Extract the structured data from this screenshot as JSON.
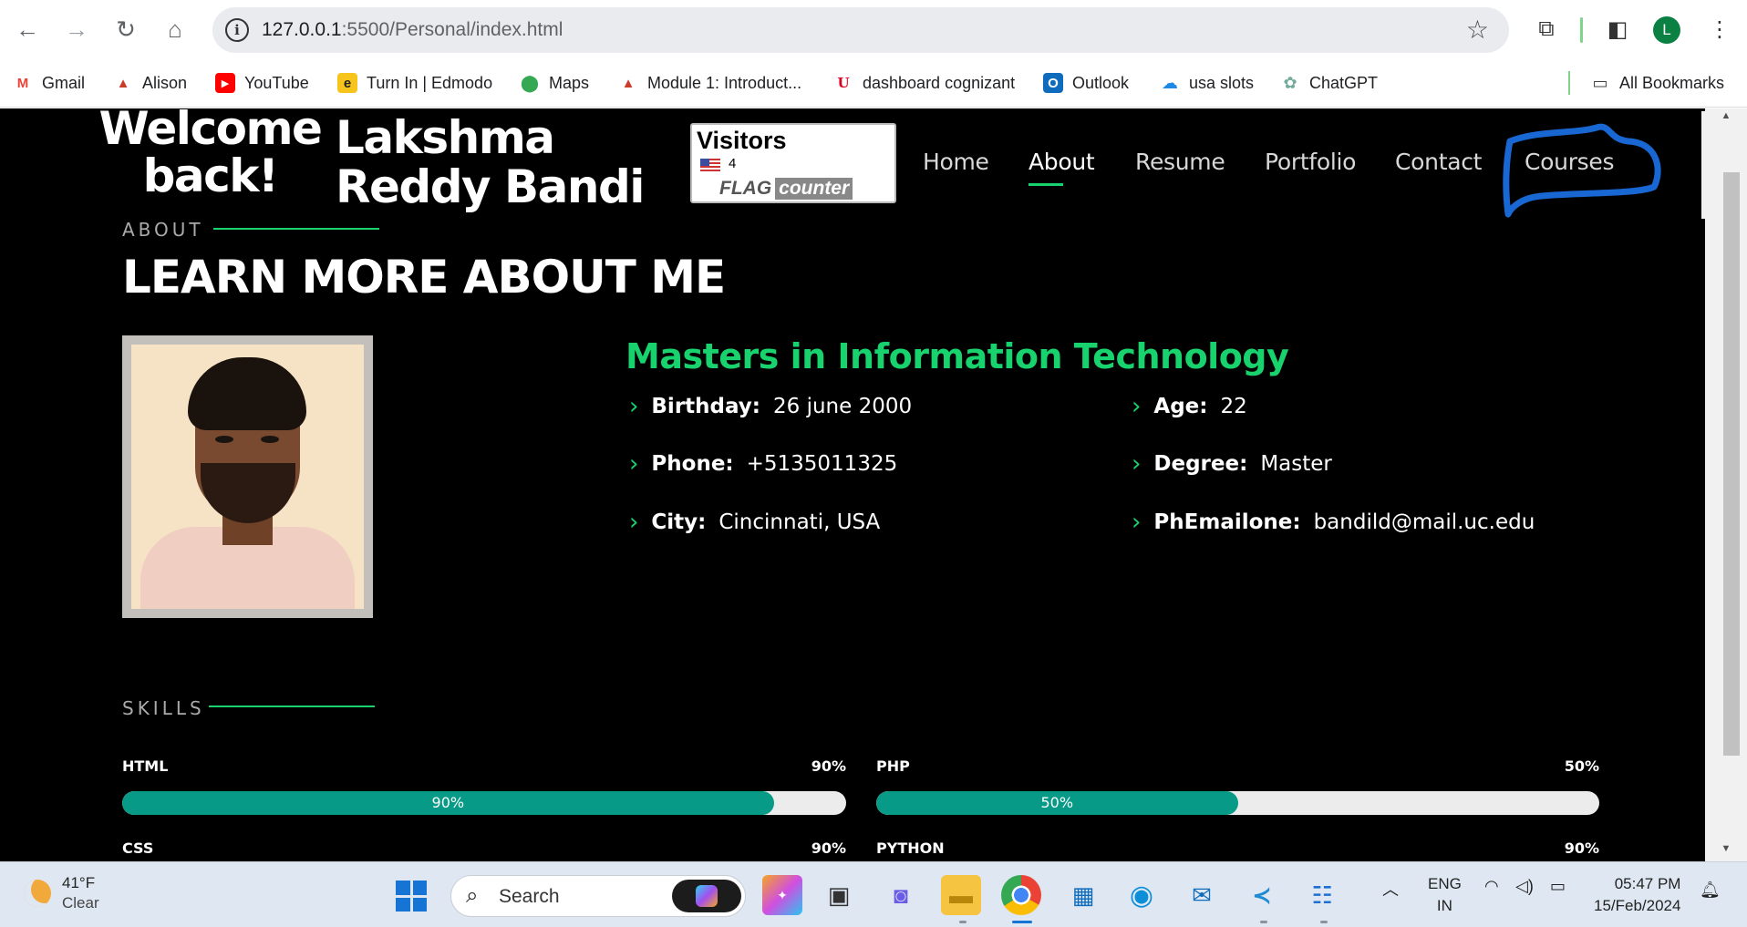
{
  "browser": {
    "url_host": "127.0.0.1",
    "url_path": ":5500/Personal/index.html",
    "profile_initial": "L",
    "nav_icons": [
      "back-icon",
      "forward-icon",
      "reload-icon",
      "home-icon"
    ]
  },
  "bookmarks": {
    "items": [
      {
        "label": "Gmail",
        "icon": "gmail-icon",
        "color": "#ea4335"
      },
      {
        "label": "Alison",
        "icon": "alison-icon",
        "color": "#cc3b2a"
      },
      {
        "label": "YouTube",
        "icon": "youtube-icon",
        "color": "#ff0000"
      },
      {
        "label": "Turn In | Edmodo",
        "icon": "edmodo-icon",
        "color": "#f6c41a"
      },
      {
        "label": "Maps",
        "icon": "maps-icon",
        "color": "#34a853"
      },
      {
        "label": "Module 1: Introduct...",
        "icon": "alison-icon",
        "color": "#cc3b2a"
      },
      {
        "label": "dashboard cognizant",
        "icon": "uc-icon",
        "color": "#e00122"
      },
      {
        "label": "Outlook",
        "icon": "outlook-icon",
        "color": "#0f6cbd"
      },
      {
        "label": "usa slots",
        "icon": "cloud-icon",
        "color": "#1e88e5"
      },
      {
        "label": "ChatGPT",
        "icon": "chatgpt-icon",
        "color": "#74aa9c"
      }
    ],
    "all_bookmarks": "All Bookmarks"
  },
  "header": {
    "welcome": "Welcome back!",
    "name": "Lakshma Reddy Bandi",
    "nav": [
      "Home",
      "About",
      "Resume",
      "Portfolio",
      "Contact",
      "Courses"
    ],
    "active_nav": "About",
    "accent": "#18d26e",
    "annotation_color": "#1967d2"
  },
  "visitor_counter": {
    "title": "Visitors",
    "count": "4",
    "brand_flag": "FLAG",
    "brand_counter": "counter"
  },
  "about": {
    "section_label": "ABOUT",
    "heading": "LEARN MORE ABOUT ME",
    "subtitle": "Masters in Information Technology",
    "details": [
      {
        "key": "Birthday:",
        "value": "26 june 2000"
      },
      {
        "key": "Age:",
        "value": "22"
      },
      {
        "key": "Phone:",
        "value": "+5135011325"
      },
      {
        "key": "Degree:",
        "value": "Master"
      },
      {
        "key": "City:",
        "value": "Cincinnati, USA"
      },
      {
        "key": "PhEmailone:",
        "value": "bandild@mail.uc.edu"
      }
    ]
  },
  "skills": {
    "section_label": "SKILLS",
    "items": [
      {
        "name": "HTML",
        "pct_label": "90%",
        "bar_label": "90%",
        "level": 90
      },
      {
        "name": "PHP",
        "pct_label": "50%",
        "bar_label": "50%",
        "level": 50
      },
      {
        "name": "CSS",
        "pct_label": "90%",
        "level": 90
      },
      {
        "name": "PYTHON",
        "pct_label": "90%",
        "level": 90
      }
    ],
    "fill_color": "#079a86"
  },
  "taskbar": {
    "weather_temp": "41°F",
    "weather_desc": "Clear",
    "search_placeholder": "Search",
    "lang_1": "ENG",
    "lang_2": "IN",
    "time": "05:47 PM",
    "date": "15/Feb/2024"
  }
}
